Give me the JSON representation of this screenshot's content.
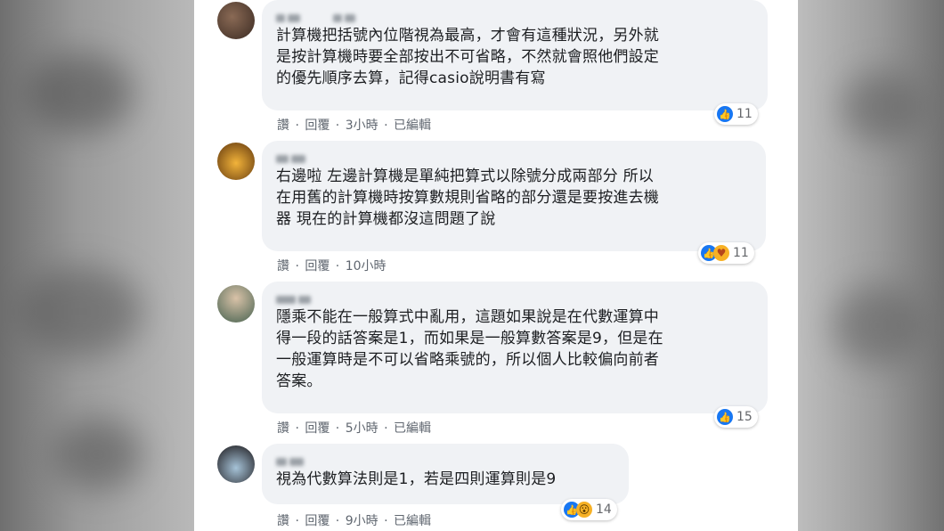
{
  "comments": [
    {
      "text": "計算機把括號內位階視為最高，才會有這種狀況，另外就\n是按計算機時要全部按出不可省略，不然就會照他們設定\n的優先順序去算，記得casio說明書有寫",
      "meta": [
        "讚",
        "回覆",
        "3小時",
        "已編輯"
      ],
      "reactions": {
        "icons": [
          "like-icon"
        ],
        "count": "11"
      }
    },
    {
      "text": "右邊啦 左邊計算機是單純把算式以除號分成兩部分 所以\n在用舊的計算機時按算數規則省略的部分還是要按進去機\n器 現在的計算機都沒這問題了說",
      "meta": [
        "讚",
        "回覆",
        "10小時"
      ],
      "reactions": {
        "icons": [
          "like-icon",
          "care-icon"
        ],
        "count": "11"
      }
    },
    {
      "text": "隱乘不能在一般算式中亂用，這題如果說是在代數運算中\n得一段的話答案是1，而如果是一般算數答案是9，但是在\n一般運算時是不可以省略乘號的，所以個人比較偏向前者\n答案。",
      "meta": [
        "讚",
        "回覆",
        "5小時",
        "已編輯"
      ],
      "reactions": {
        "icons": [
          "like-icon"
        ],
        "count": "15"
      }
    },
    {
      "text": "視為代數算法則是1，若是四則運算則是9",
      "meta": [
        "讚",
        "回覆",
        "9小時",
        "已編輯"
      ],
      "reactions": {
        "icons": [
          "like-icon",
          "wow-icon"
        ],
        "count": "14"
      }
    }
  ],
  "colors": {
    "like": "#1877f2",
    "bubble": "#f0f2f5",
    "meta": "#606770"
  }
}
